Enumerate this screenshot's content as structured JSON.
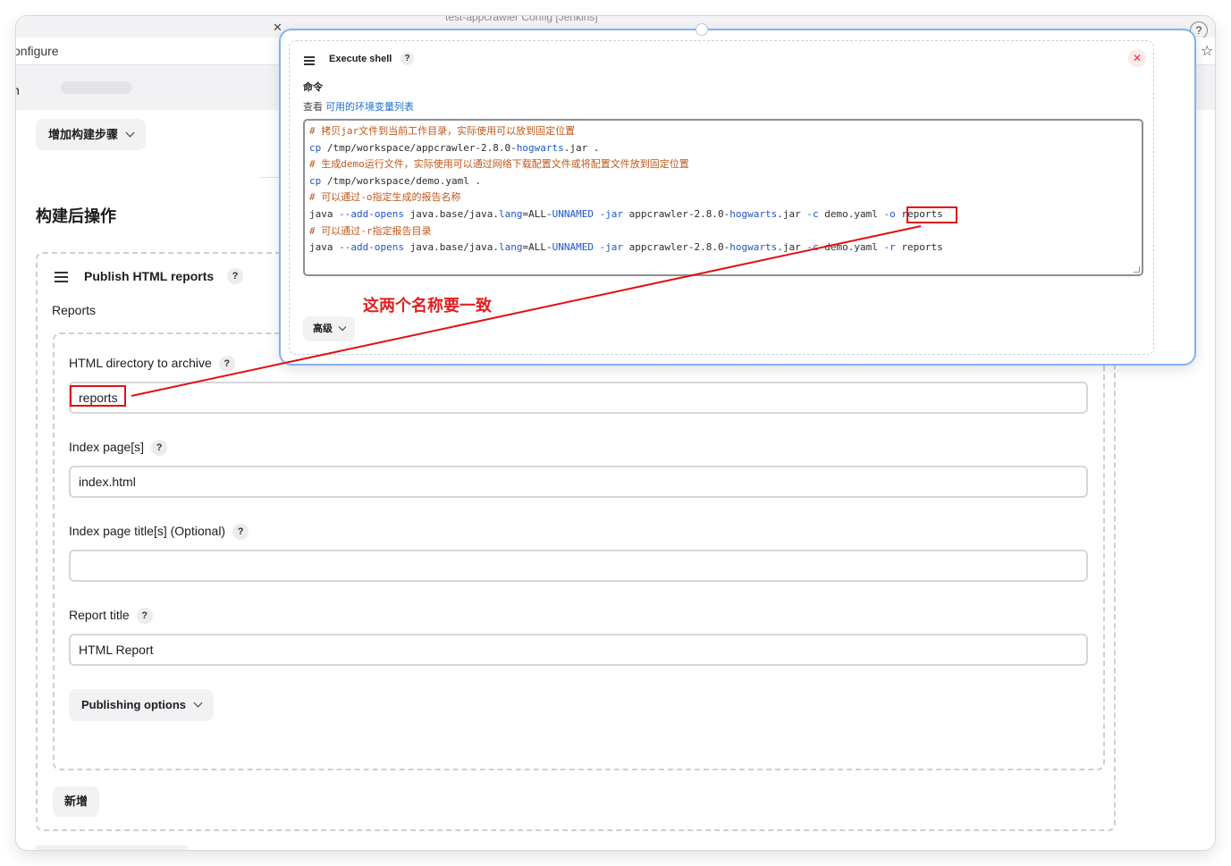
{
  "browser": {
    "window_title": "test-appcrawler Config [Jenkins]",
    "address_fragment": "onfigure",
    "breadcrumb_fragment": "n"
  },
  "jenkins": {
    "add_build_step_label": "增加构建步骤",
    "post_build_heading": "构建后操作",
    "publish_html": {
      "title": "Publish HTML reports",
      "reports_label": "Reports",
      "fields": {
        "html_dir": {
          "label": "HTML directory to archive",
          "value": "reports"
        },
        "index_pages": {
          "label": "Index page[s]",
          "value": "index.html"
        },
        "index_titles": {
          "label": "Index page title[s] (Optional)",
          "value": ""
        },
        "report_title": {
          "label": "Report title",
          "value": "HTML Report"
        }
      },
      "publishing_options_label": "Publishing options",
      "add_button_label": "新增"
    }
  },
  "execute_shell": {
    "title": "Execute shell",
    "command_label": "命令",
    "env_prefix": "查看 ",
    "env_link": "可用的环境变量列表",
    "code_lines": [
      {
        "type": "comment",
        "text": "# 拷贝jar文件到当前工作目录，实际使用可以放到固定位置"
      },
      {
        "type": "cmd",
        "parts": [
          [
            "kw",
            "cp"
          ],
          [
            "t",
            " /tmp/workspace/appcrawler-2.8.0-"
          ],
          [
            "kw",
            "hogwarts"
          ],
          [
            "t",
            ".jar ."
          ]
        ]
      },
      {
        "type": "comment",
        "text": "# 生成demo运行文件，实际使用可以通过网络下载配置文件或将配置文件放到固定位置"
      },
      {
        "type": "cmd",
        "parts": [
          [
            "kw",
            "cp"
          ],
          [
            "t",
            " /tmp/workspace/demo.yaml ."
          ]
        ]
      },
      {
        "type": "comment",
        "text": "# 可以通过-o指定生成的报告名称"
      },
      {
        "type": "cmd",
        "parts": [
          [
            "t",
            "java "
          ],
          [
            "kw",
            "--add-opens"
          ],
          [
            "t",
            " java.base/java."
          ],
          [
            "kw",
            "lang"
          ],
          [
            "t",
            "=ALL-"
          ],
          [
            "kw",
            "UNNAMED"
          ],
          [
            "t",
            " "
          ],
          [
            "kw",
            "-jar"
          ],
          [
            "t",
            " appcrawler-2.8.0-"
          ],
          [
            "kw",
            "hogwarts"
          ],
          [
            "t",
            ".jar "
          ],
          [
            "kw",
            "-c"
          ],
          [
            "t",
            " demo.yaml "
          ],
          [
            "kw",
            "-o"
          ],
          [
            "t",
            " reports"
          ]
        ]
      },
      {
        "type": "comment",
        "text": "# 可以通过-r指定报告目录"
      },
      {
        "type": "cmd",
        "parts": [
          [
            "t",
            "java "
          ],
          [
            "kw",
            "--add-opens"
          ],
          [
            "t",
            " java.base/java."
          ],
          [
            "kw",
            "lang"
          ],
          [
            "t",
            "=ALL-"
          ],
          [
            "kw",
            "UNNAMED"
          ],
          [
            "t",
            " "
          ],
          [
            "kw",
            "-jar"
          ],
          [
            "t",
            " appcrawler-2.8.0-"
          ],
          [
            "kw",
            "hogwarts"
          ],
          [
            "t",
            ".jar "
          ],
          [
            "kw",
            "-c"
          ],
          [
            "t",
            " demo.yaml "
          ],
          [
            "kw",
            "-r"
          ],
          [
            "t",
            " reports"
          ]
        ]
      }
    ],
    "advanced_label": "高级"
  },
  "annotation": {
    "text": "这两个名称要一致",
    "color": "#e02020"
  },
  "colors": {
    "comment": "#c0581a",
    "keyword": "#1f55c8",
    "popup_border": "#82b3f0",
    "annotation_red": "#e01010"
  },
  "icons": [
    "drag-handle-icon",
    "help-icon",
    "close-icon",
    "chevron-down-icon",
    "star-icon"
  ]
}
